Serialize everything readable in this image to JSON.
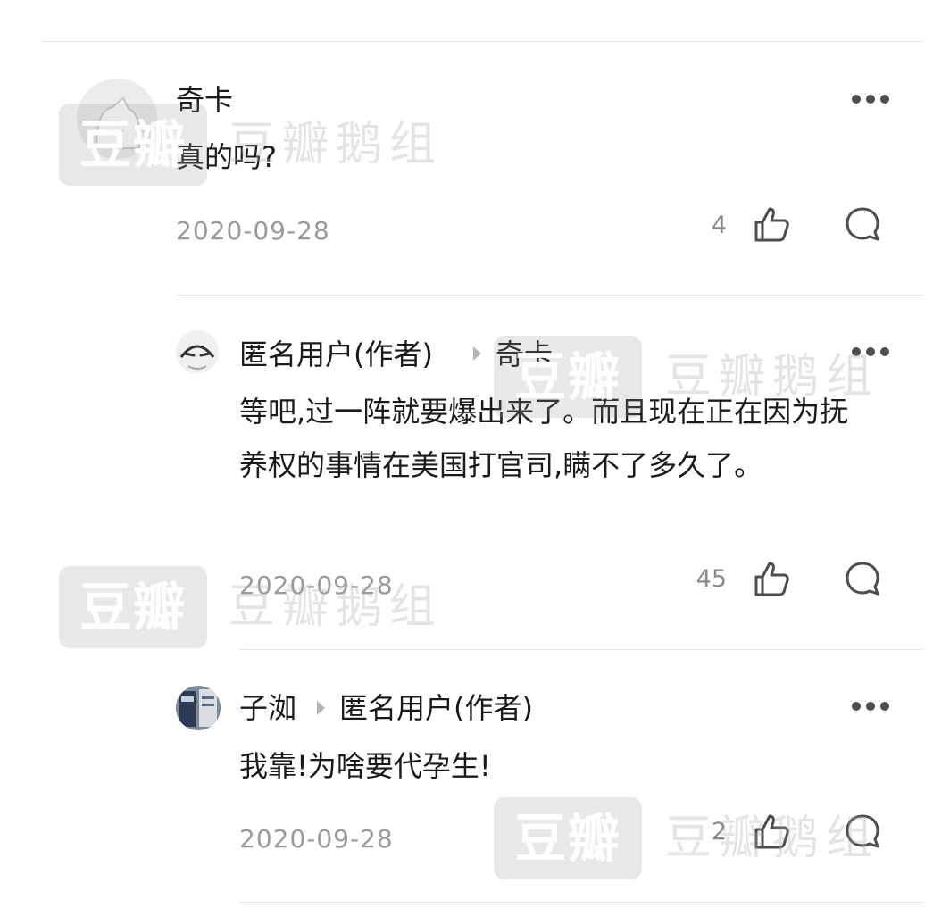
{
  "comments": [
    {
      "author": "奇卡",
      "reply_to": "",
      "content": "真的吗?",
      "date": "2020-09-28",
      "likes": "4",
      "avatar_icon": "cat-doodle-avatar"
    },
    {
      "author": "匿名用户(作者)",
      "reply_to": "奇卡",
      "content": "等吧,过一阵就要爆出来了。而且现在正在因为抚养权的事情在美国打官司,瞒不了多久了。",
      "date": "2020-09-28",
      "likes": "45",
      "avatar_icon": "anonymous-face-avatar"
    },
    {
      "author": "子洳",
      "reply_to": "匿名用户(作者)",
      "content": "我靠!为啥要代孕生!",
      "date": "2020-09-28",
      "likes": "2",
      "avatar_icon": "photo-avatar"
    }
  ],
  "watermark": {
    "logo": "豆瓣",
    "group": "豆瓣鹅组"
  },
  "icons": {
    "like": "thumbs-up-icon",
    "reply": "speech-bubble-icon",
    "more": "more-dots-icon",
    "reply_arrow": "reply-arrow-icon"
  },
  "colors": {
    "text": "#1a1a1a",
    "meta": "#9a9a9a",
    "divider": "#e6e6e6",
    "icon": "#4d4d4d"
  }
}
